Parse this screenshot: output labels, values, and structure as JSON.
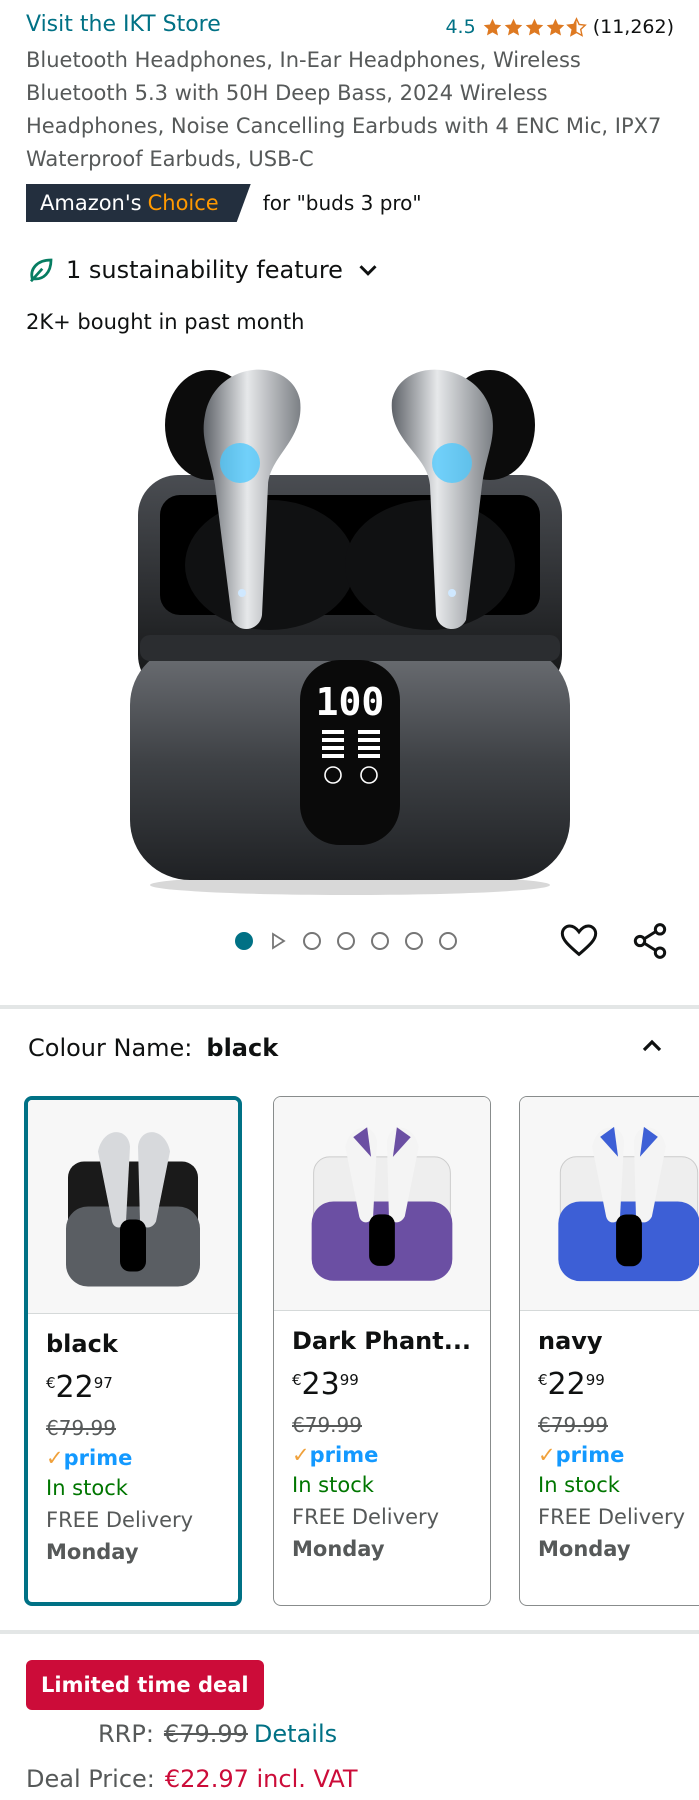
{
  "store": {
    "link": "Visit the IKT Store",
    "rating": "4.5",
    "rating_count": "(11,262)",
    "stars": 4.5
  },
  "product": {
    "title": "Bluetooth Headphones, In-Ear Headphones, Wireless Bluetooth 5.3 with 50H Deep Bass, 2024 Wireless Headphones, Noise Cancelling Earbuds with 4 ENC Mic, IPX7 Waterproof Earbuds, USB-C",
    "badge_prefix": "Amazon's",
    "badge_choice": "Choice",
    "badge_query": "for \"buds 3 pro\"",
    "sustainability": "1 sustainability feature",
    "bought": "2K+ bought in past month",
    "screen_digits": "100"
  },
  "gallery": {
    "image_count": 6,
    "active_index": 0
  },
  "colour": {
    "label": "Colour Name:",
    "value": "black",
    "options": [
      {
        "name": "black",
        "price_main": "22",
        "price_frac": "97",
        "currency": "€",
        "rrp": "€79.99",
        "prime": "prime",
        "stock": "In stock",
        "delivery": "FREE Delivery",
        "day": "Monday",
        "color": "#5a5e63"
      },
      {
        "name": "Dark Phant...",
        "price_main": "23",
        "price_frac": "99",
        "currency": "€",
        "rrp": "€79.99",
        "prime": "prime",
        "stock": "In stock",
        "delivery": "FREE Delivery",
        "day": "Monday",
        "color": "#6b4fa3"
      },
      {
        "name": "navy",
        "price_main": "22",
        "price_frac": "99",
        "currency": "€",
        "rrp": "€79.99",
        "prime": "prime",
        "stock": "In stock",
        "delivery": "FREE Delivery",
        "day": "Monday",
        "color": "#3d5fd6"
      }
    ]
  },
  "deal": {
    "badge": "Limited time deal",
    "rrp_label": "RRP:",
    "rrp_value": "€79.99",
    "details": "Details",
    "deal_label": "Deal Price:",
    "deal_value": "€22.97 incl. VAT"
  },
  "colors": {
    "link": "#007185",
    "deal_red": "#cc0c39",
    "badge_dark": "#232f3e",
    "choice_orange": "#ff9900",
    "stock_green": "#007600",
    "prime_blue": "#1399ff"
  },
  "icons": [
    "star-icon",
    "leaf-icon",
    "chevron-down-icon",
    "play-icon",
    "heart-icon",
    "share-icon",
    "chevron-up-icon",
    "prime-check-icon"
  ]
}
